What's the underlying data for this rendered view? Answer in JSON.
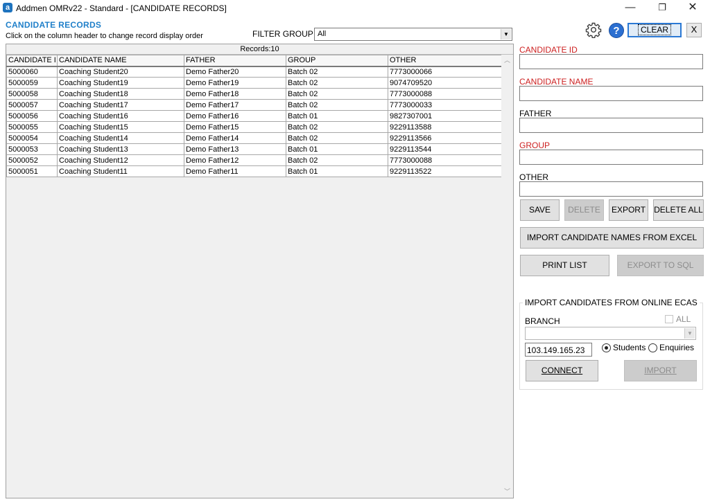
{
  "window": {
    "title": "Addmen OMRv22 - Standard - [CANDIDATE RECORDS]",
    "app_icon": "a",
    "minimize": "—",
    "maximize": "❐",
    "close": "✕"
  },
  "header": {
    "title": "CANDIDATE RECORDS",
    "hint": "Click on the column header to change record display order"
  },
  "filter": {
    "label": "FILTER GROUP",
    "value": "All"
  },
  "grid": {
    "records_label": "Records:10",
    "columns": [
      "CANDIDATE I",
      "CANDIDATE NAME",
      "FATHER",
      "GROUP",
      "OTHER"
    ],
    "rows": [
      [
        "5000060",
        "Coaching Student20",
        "Demo Father20",
        "Batch 02",
        "7773000066"
      ],
      [
        "5000059",
        "Coaching Student19",
        "Demo Father19",
        "Batch 02",
        "9074709520"
      ],
      [
        "5000058",
        "Coaching Student18",
        "Demo Father18",
        "Batch 02",
        "7773000088"
      ],
      [
        "5000057",
        "Coaching Student17",
        "Demo Father17",
        "Batch 02",
        "7773000033"
      ],
      [
        "5000056",
        "Coaching Student16",
        "Demo Father16",
        "Batch 01",
        "9827307001"
      ],
      [
        "5000055",
        "Coaching Student15",
        "Demo Father15",
        "Batch 02",
        "9229113588"
      ],
      [
        "5000054",
        "Coaching Student14",
        "Demo Father14",
        "Batch 02",
        "9229113566"
      ],
      [
        "5000053",
        "Coaching Student13",
        "Demo Father13",
        "Batch 01",
        "9229113544"
      ],
      [
        "5000052",
        "Coaching Student12",
        "Demo Father12",
        "Batch 02",
        "7773000088"
      ],
      [
        "5000051",
        "Coaching Student11",
        "Demo Father11",
        "Batch 01",
        "9229113522"
      ]
    ]
  },
  "toolbar": {
    "help": "?",
    "clear": "CLEAR",
    "close_panel": "X"
  },
  "form": {
    "candidate_id_label": "CANDIDATE ID",
    "candidate_name_label": "CANDIDATE NAME",
    "father_label": "FATHER",
    "group_label": "GROUP",
    "other_label": "OTHER",
    "required_color": "#cc1f1f"
  },
  "actions": {
    "save": "SAVE",
    "delete": "DELETE",
    "export": "EXPORT",
    "delete_all": "DELETE ALL",
    "import_excel": "IMPORT CANDIDATE NAMES FROM EXCEL",
    "print_list": "PRINT LIST",
    "export_sql": "EXPORT TO SQL"
  },
  "import_ecas": {
    "title": "IMPORT CANDIDATES FROM ONLINE ECAS",
    "branch_label": "BRANCH",
    "all_label": "ALL",
    "ip_value": "103.149.165.23",
    "students_label": "Students",
    "enquiries_label": "Enquiries",
    "selected": "Students",
    "connect": "CONNECT",
    "import": "IMPORT"
  }
}
